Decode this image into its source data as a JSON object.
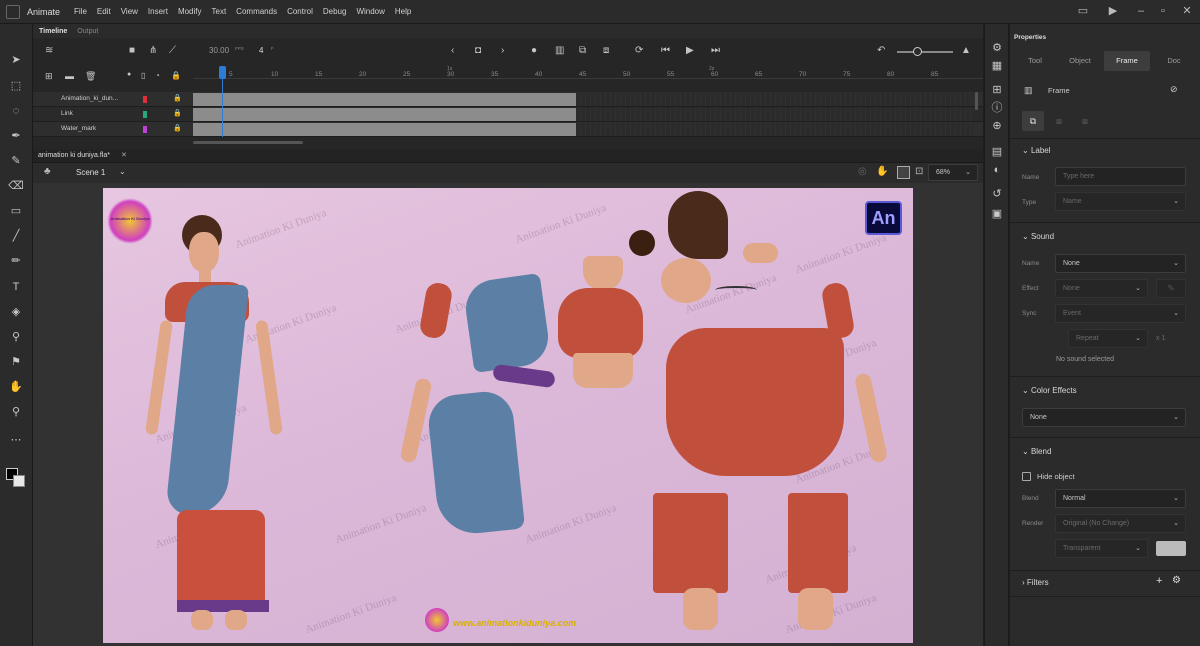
{
  "menu": {
    "app": "Animate",
    "items": [
      "File",
      "Edit",
      "View",
      "Insert",
      "Modify",
      "Text",
      "Commands",
      "Control",
      "Debug",
      "Window",
      "Help"
    ]
  },
  "timeline": {
    "tabs": [
      "Timeline",
      "Output"
    ],
    "fps": "30.00",
    "fps_unit": "FPS",
    "frame": "4",
    "frame_unit": "F",
    "ruler_ticks": [
      "5",
      "10",
      "15",
      "20",
      "25",
      "30",
      "35",
      "40",
      "45",
      "50",
      "55",
      "60",
      "65",
      "70",
      "75",
      "80",
      "85"
    ],
    "second_marks": [
      "1s",
      "2s"
    ],
    "layers": [
      {
        "name": "Animation_ki_dun...",
        "color": "#e0303a"
      },
      {
        "name": "Link",
        "color": "#2aa87a"
      },
      {
        "name": "Water_mark",
        "color": "#c040d8"
      }
    ]
  },
  "document": {
    "tab_title": "animation ki duniya.fla*",
    "scene": "Scene 1",
    "zoom": "68%"
  },
  "stage": {
    "watermark_text": "Animation Ki Duniya",
    "logo_text": "An",
    "website": "www.animationkiduniya.com",
    "badge_text": "Animation Ki Duniya"
  },
  "properties": {
    "title": "Properties",
    "tabs": [
      "Tool",
      "Object",
      "Frame",
      "Doc"
    ],
    "active_tab": "Frame",
    "panel_title": "Frame",
    "label": {
      "section": "Label",
      "name_label": "Name",
      "name_placeholder": "Type here",
      "type_label": "Type",
      "type_value": "Name"
    },
    "sound": {
      "section": "Sound",
      "name_label": "Name",
      "name_value": "None",
      "effect_label": "Effect",
      "effect_value": "None",
      "sync_label": "Sync",
      "sync_value": "Event",
      "repeat_value": "Repeat",
      "repeat_count": "x 1",
      "status": "No sound selected"
    },
    "color_effects": {
      "section": "Color Effects",
      "value": "None"
    },
    "blend": {
      "section": "Blend",
      "hide_object": "Hide object",
      "blend_label": "Blend",
      "blend_value": "Normal",
      "render_label": "Render",
      "render_value": "Original (No Change)",
      "bg_value": "Transparent"
    },
    "filters": {
      "section": "Filters"
    }
  },
  "colors": {
    "accent": "#1473e6",
    "playhead": "#2d7cd6",
    "stage_bg": "#dcb8d8",
    "panel_bg": "#2b2b2b"
  }
}
